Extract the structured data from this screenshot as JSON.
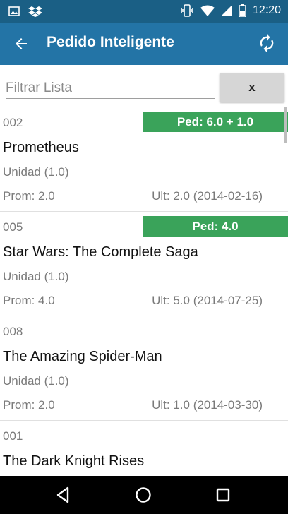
{
  "status_bar": {
    "time": "12:20",
    "left_icons": [
      "image-icon",
      "dropbox-icon"
    ],
    "right_icons": [
      "vibrate-icon",
      "wifi-icon",
      "signal-icon",
      "battery-icon"
    ]
  },
  "app_bar": {
    "title": "Pedido Inteligente",
    "back_icon": "arrow-left-icon",
    "refresh_icon": "refresh-icon"
  },
  "filter": {
    "placeholder": "Filtrar Lista",
    "value": "",
    "clear_label": "x"
  },
  "colors": {
    "status_bar": "#1a5f85",
    "app_bar": "#2374a6",
    "badge": "#3aa35a"
  },
  "items": [
    {
      "code": "002",
      "badge": "Ped: 6.0 + 1.0",
      "name": "Prometheus",
      "unit": "Unidad (1.0)",
      "prom": "Prom: 2.0",
      "ult": "Ult: 2.0 (2014-02-16)"
    },
    {
      "code": "005",
      "badge": "Ped: 4.0",
      "name": "Star Wars: The Complete Saga",
      "unit": "Unidad (1.0)",
      "prom": "Prom: 4.0",
      "ult": "Ult: 5.0 (2014-07-25)"
    },
    {
      "code": "008",
      "badge": "",
      "name": "The Amazing Spider-Man",
      "unit": "Unidad (1.0)",
      "prom": "Prom: 2.0",
      "ult": "Ult: 1.0 (2014-03-30)"
    },
    {
      "code": "001",
      "badge": "",
      "name": "The Dark Knight Rises",
      "unit": "",
      "prom": "",
      "ult": ""
    }
  ],
  "nav_bar": {
    "icons": [
      "back-triangle-icon",
      "home-circle-icon",
      "recents-square-icon"
    ]
  }
}
